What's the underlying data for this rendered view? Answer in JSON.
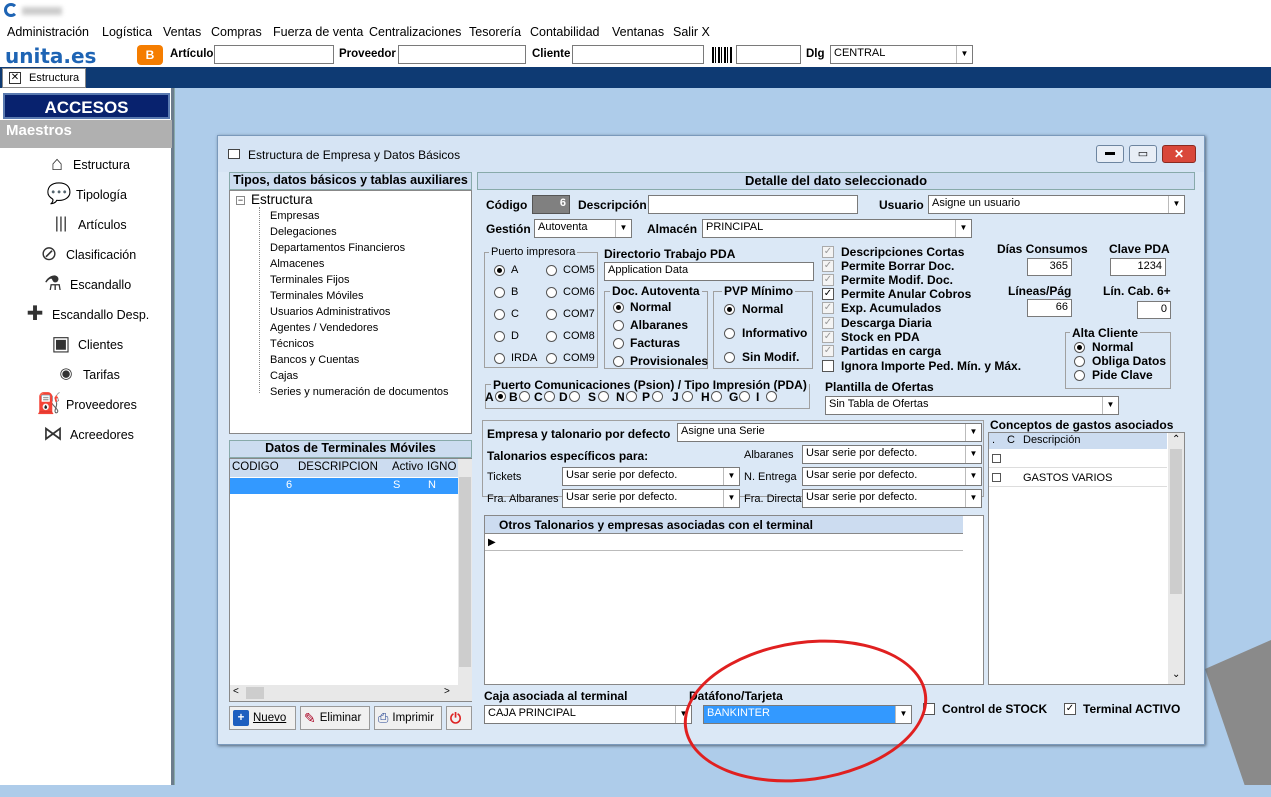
{
  "menu": [
    "Administración",
    "Logística",
    "Ventas",
    "Compras",
    "Fuerza de venta",
    "Centralizaciones",
    "Tesorería",
    "Contabilidad",
    "Ventanas",
    "Salir X"
  ],
  "toolbar": {
    "brand": "unita.es",
    "articulo_label": "Artículo",
    "proveedor_label": "Proveedor",
    "cliente_label": "Cliente",
    "dlg_label": "Dlg",
    "dlg_value": "CENTRAL"
  },
  "tab": {
    "label": "Estructura"
  },
  "quick_access": {
    "title": "ACCESOS RAPIDOS",
    "section": "Maestros",
    "items": [
      "Estructura",
      "Tipología",
      "Artículos",
      "Clasificación",
      "Escandallo",
      "Escandallo Desp.",
      "Clientes",
      "Tarifas",
      "Proveedores",
      "Acreedores"
    ]
  },
  "window": {
    "title": "Estructura de Empresa y Datos Básicos"
  },
  "left": {
    "tree_header": "Tipos, datos básicos y tablas auxiliares",
    "tree_root": "Estructura",
    "tree_items": [
      "Empresas",
      "Delegaciones",
      "Departamentos Financieros",
      "Almacenes",
      "Terminales Fijos",
      "Terminales Móviles",
      "Usuarios Administrativos",
      "Agentes / Vendedores",
      "Técnicos",
      "Bancos y Cuentas",
      "Cajas",
      "Series y numeración de documentos"
    ],
    "grid_header": "Datos de Terminales Móviles",
    "grid_cols": [
      "CODIGO",
      "DESCRIPCION",
      "Activo",
      "IGNO"
    ],
    "grid_row": [
      "6",
      "",
      "S",
      "N"
    ],
    "buttons": [
      "Nuevo",
      "Eliminar",
      "Imprimir"
    ]
  },
  "detail": {
    "header": "Detalle del dato seleccionado",
    "codigo_label": "Código",
    "codigo_value": "6",
    "descripcion_label": "Descripción",
    "descripcion_value": "",
    "usuario_label": "Usuario",
    "usuario_value": "Asigne un usuario",
    "gestion_label": "Gestión",
    "gestion_value": "Autoventa",
    "almacen_label": "Almacén",
    "almacen_value": "PRINCIPAL",
    "puerto_label": "Puerto impresora",
    "puertos_left": [
      "A",
      "B",
      "C",
      "D",
      "IRDA"
    ],
    "puertos_right": [
      "COM5",
      "COM6",
      "COM7",
      "COM8",
      "COM9"
    ],
    "directorio_label": "Directorio Trabajo PDA",
    "directorio_value": "Application Data",
    "doc_label": "Doc. Autoventa",
    "doc_options": [
      "Normal",
      "Albaranes",
      "Facturas",
      "Provisionales"
    ],
    "pvp_label": "PVP Mínimo",
    "pvp_options": [
      "Normal",
      "Informativo",
      "Sin Modif."
    ],
    "checks": [
      "Descripciones Cortas",
      "Permite Borrar Doc.",
      "Permite Modif. Doc.",
      "Permite Anular Cobros",
      "Exp. Acumulados",
      "Descarga Diaria",
      "Stock en PDA",
      "Partidas en carga",
      "Ignora Importe Ped. Mín. y Máx."
    ],
    "dias_label": "Días Consumos",
    "dias_value": "365",
    "clave_label": "Clave PDA",
    "clave_value": "1234",
    "lineas_label": "Líneas/Pág",
    "lineas_value": "66",
    "lin_cab_label": "Lín. Cab. 6+",
    "lin_cab_value": "0",
    "alta_label": "Alta Cliente",
    "alta_options": [
      "Normal",
      "Obliga Datos",
      "Pide Clave"
    ],
    "com_label": "Puerto Comunicaciones (Psion) / Tipo Impresión (PDA)",
    "com_options": [
      "A",
      "B",
      "C",
      "D",
      "S",
      "N",
      "P",
      "J",
      "H",
      "G",
      "I"
    ],
    "plantilla_label": "Plantilla de Ofertas",
    "plantilla_value": "Sin Tabla de Ofertas",
    "empresa_label": "Empresa y talonario por defecto",
    "empresa_value": "Asigne una Serie",
    "talonarios_label": "Talonarios específicos para:",
    "tickets_label": "Tickets",
    "fra_alb_label": "Fra. Albaranes",
    "albaranes_label": "Albaranes",
    "n_entrega_label": "N. Entrega",
    "fra_directa_label": "Fra. Directa",
    "serie_default": "Usar serie por defecto.",
    "otros_label": "Otros Talonarios y empresas asociadas con el terminal",
    "conceptos_label": "Conceptos de gastos asociados",
    "conceptos_cols": [
      ".",
      "C",
      "Descripción"
    ],
    "conceptos_rows": [
      "",
      "GASTOS VARIOS"
    ],
    "caja_label": "Caja asociada al terminal",
    "caja_value": "CAJA PRINCIPAL",
    "datafono_label": "Datáfono/Tarjeta",
    "datafono_value": "BANKINTER",
    "stock_label": "Control de STOCK",
    "activo_label": "Terminal ACTIVO"
  }
}
